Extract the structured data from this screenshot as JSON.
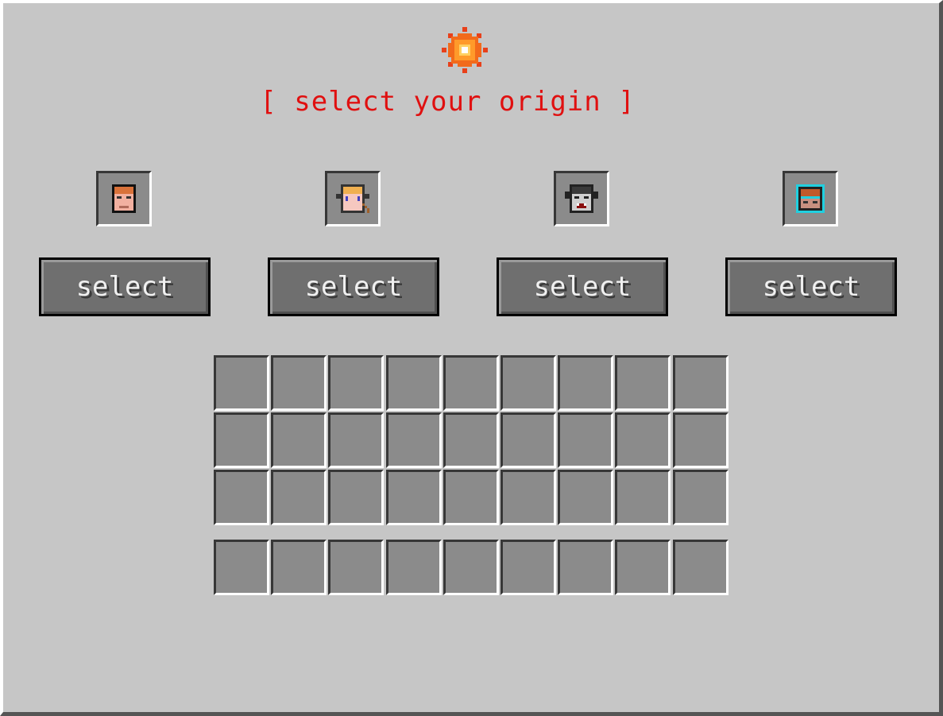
{
  "title": "[ select your origin ]",
  "icon": "sun-orb-icon",
  "origins": [
    {
      "icon": "human-face-icon",
      "button_label": "select"
    },
    {
      "icon": "elf-face-icon",
      "button_label": "select"
    },
    {
      "icon": "vampire-face-icon",
      "button_label": "select"
    },
    {
      "icon": "diver-face-icon",
      "button_label": "select"
    }
  ],
  "inventory": {
    "rows": 3,
    "cols": 9
  },
  "hotbar": {
    "cols": 9
  },
  "colors": {
    "background": "#c6c6c6",
    "title": "#e01010",
    "slot": "#8b8b8b",
    "button": "#6f6f6f"
  }
}
